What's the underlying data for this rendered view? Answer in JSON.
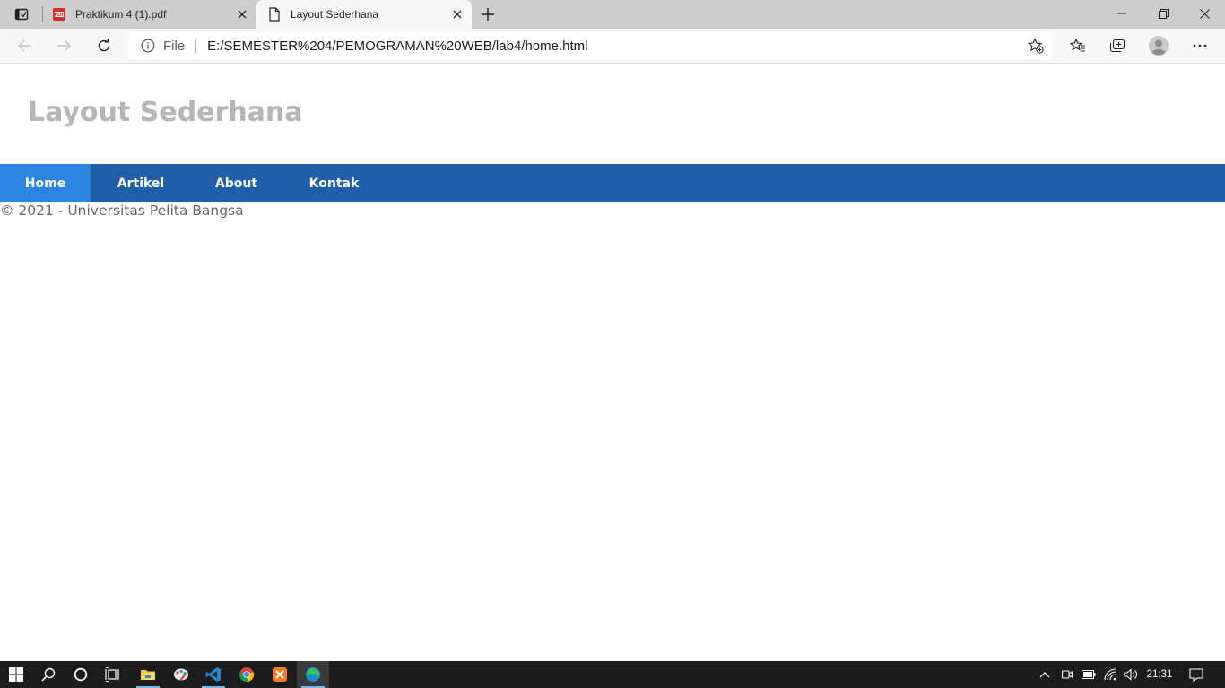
{
  "browser": {
    "tabs": [
      {
        "title": "Praktikum 4 (1).pdf",
        "favicon": "pdf-icon",
        "active": false
      },
      {
        "title": "Layout Sederhana",
        "favicon": "page-icon",
        "active": true
      }
    ],
    "address": {
      "scheme_label": "File",
      "url": "E:/SEMESTER%204/PEMOGRAMAN%20WEB/lab4/home.html"
    },
    "toolbar_icons": [
      "back-icon",
      "forward-icon",
      "refresh-icon",
      "info-icon",
      "add-favorite-icon",
      "favorites-icon",
      "collections-icon",
      "profile-icon",
      "more-icon"
    ],
    "window_controls": [
      "minimize-icon",
      "restore-icon",
      "close-icon"
    ]
  },
  "page": {
    "header_title": "Layout Sederhana",
    "nav": [
      {
        "label": "Home",
        "active": true
      },
      {
        "label": "Artikel",
        "active": false
      },
      {
        "label": "About",
        "active": false
      },
      {
        "label": "Kontak",
        "active": false
      }
    ],
    "footer_text": "© 2021 - Universitas Pelita Bangsa",
    "colors": {
      "nav_bg": "#1f5faa",
      "nav_active_bg": "#2b83e2",
      "title_color": "#b5b5b5"
    }
  },
  "taskbar": {
    "apps": [
      "windows-start-icon",
      "search-icon",
      "cortana-icon",
      "task-view-icon",
      "file-explorer-icon",
      "paint-icon",
      "vscode-icon",
      "chrome-icon",
      "xampp-icon",
      "edge-icon"
    ],
    "tray_icons": [
      "chevron-up-icon",
      "meet-now-icon",
      "battery-icon",
      "wifi-icon",
      "volume-icon",
      "notification-icon"
    ],
    "clock": "21:31"
  }
}
